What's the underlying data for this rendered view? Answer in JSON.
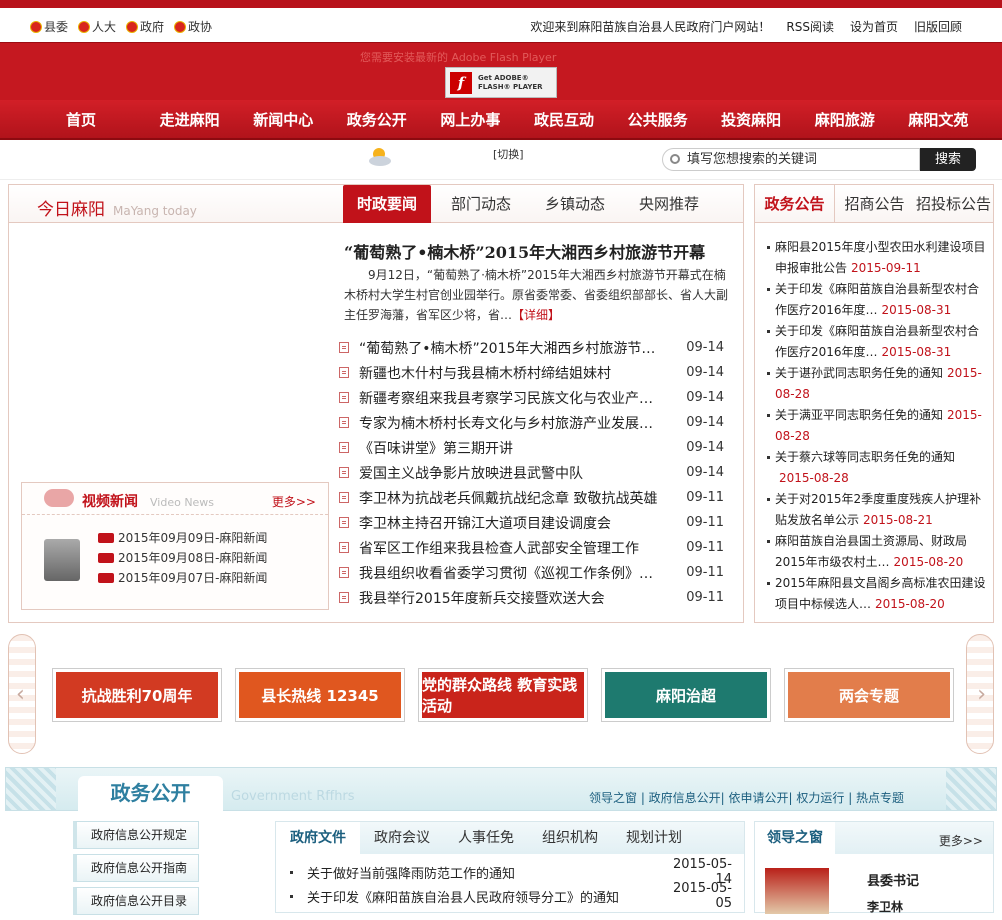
{
  "topbar": {
    "org_links": [
      "县委",
      "人大",
      "政府",
      "政协"
    ],
    "welcome": "欢迎来到麻阳苗族自治县人民政府门户网站！",
    "rss": "RSS阅读",
    "set_home": "设为首页",
    "old_version": "旧版回顾"
  },
  "banner": {
    "flash_hint": "您需要安装最新的 Adobe Flash Player",
    "flash_btn_line1": "Get ADOBE®",
    "flash_btn_line2": "FLASH® PLAYER"
  },
  "nav": [
    "首页",
    "走进麻阳",
    "新闻中心",
    "政务公开",
    "网上办事",
    "政民互动",
    "公共服务",
    "投资麻阳",
    "麻阳旅游",
    "麻阳文苑"
  ],
  "search": {
    "switch": "[切换]",
    "placeholder": "填写您想搜索的关键词",
    "button": "搜索"
  },
  "today": {
    "title": "今日麻阳",
    "title_en": "MaYang today",
    "tabs": [
      "时政要闻",
      "部门动态",
      "乡镇动态",
      "央网推荐"
    ],
    "headline": "“葡萄熟了•楠木桥”2015年大湘西乡村旅游节开幕",
    "summary": "9月12日，“葡萄熟了·楠木桥”2015年大湘西乡村旅游节开幕式在楠木桥村大学生村官创业园举行。原省委常委、省委组织部部长、省人大副主任罗海藩，省军区少将，省…",
    "more": "【详细】",
    "news": [
      {
        "title": "“葡萄熟了•楠木桥”2015年大湘西乡村旅游节…",
        "date": "09-14"
      },
      {
        "title": "新疆也木什村与我县楠木桥村缔结姐妹村",
        "date": "09-14"
      },
      {
        "title": "新疆考察组来我县考察学习民族文化与农业产业…",
        "date": "09-14"
      },
      {
        "title": "专家为楠木桥村长寿文化与乡村旅游产业发展把…",
        "date": "09-14"
      },
      {
        "title": "《百味讲堂》第三期开讲",
        "date": "09-14"
      },
      {
        "title": "爱国主义战争影片放映进县武警中队",
        "date": "09-14"
      },
      {
        "title": "李卫林为抗战老兵佩戴抗战纪念章 致敬抗战英雄",
        "date": "09-11"
      },
      {
        "title": "李卫林主持召开锦江大道项目建设调度会",
        "date": "09-11"
      },
      {
        "title": "省军区工作组来我县检查人武部安全管理工作",
        "date": "09-11"
      },
      {
        "title": "我县组织收看省委学习贯彻《巡视工作条例》电…",
        "date": "09-11"
      },
      {
        "title": "我县举行2015年度新兵交接暨欢送大会",
        "date": "09-11"
      }
    ]
  },
  "video": {
    "title": "视频新闻",
    "title_en": "Video  News",
    "more": "更多>>",
    "items": [
      "2015年09月09日-麻阳新闻",
      "2015年09月08日-麻阳新闻",
      "2015年09月07日-麻阳新闻"
    ]
  },
  "notice": {
    "tabs": [
      "政务公告",
      "招商公告",
      "招投标公告"
    ],
    "items": [
      {
        "title": "麻阳县2015年度小型农田水利建设项目申报审批公告",
        "date": "2015-09-11"
      },
      {
        "title": "关于印发《麻阳苗族自治县新型农村合作医疗2016年度…",
        "date": "2015-08-31"
      },
      {
        "title": "关于印发《麻阳苗族自治县新型农村合作医疗2016年度…",
        "date": "2015-08-31"
      },
      {
        "title": "关于谌孙武同志职务任免的通知",
        "date": "2015-08-28"
      },
      {
        "title": "关于满亚平同志职务任免的通知",
        "date": "2015-08-28"
      },
      {
        "title": "关于蔡六球等同志职务任免的通知",
        "date": "2015-08-28"
      },
      {
        "title": "关于对2015年2季度重度残疾人护理补贴发放名单公示",
        "date": "2015-08-21"
      },
      {
        "title": "麻阳苗族自治县国土资源局、财政局2015年市级农村土…",
        "date": "2015-08-20"
      },
      {
        "title": "2015年麻阳县文昌阁乡高标准农田建设项目中标候选人…",
        "date": "2015-08-20"
      }
    ]
  },
  "banners": [
    {
      "label": "抗战胜利70周年",
      "color": "#d23a22"
    },
    {
      "label": "县长热线 12345",
      "color": "#e0571f"
    },
    {
      "label": "党的群众路线 教育实践活动",
      "color": "#c9241b"
    },
    {
      "label": "麻阳治超",
      "color": "#1e7a6f"
    },
    {
      "label": "两会专题",
      "color": "#e27d4b"
    }
  ],
  "section2": {
    "title": "政务公开",
    "title_en": "Government Rffhrs",
    "links": "领导之窗 | 政府信息公开| 依申请公开| 权力运行 | 热点专题"
  },
  "leftmenu": [
    "政府信息公开规定",
    "政府信息公开指南",
    "政府信息公开目录"
  ],
  "gov": {
    "tabs": [
      "政府文件",
      "政府会议",
      "人事任免",
      "组织机构",
      "规划计划"
    ],
    "items": [
      {
        "title": "关于做好当前强降雨防范工作的通知",
        "date": "2015-05-14"
      },
      {
        "title": "关于印发《麻阳苗族自治县人民政府领导分工》的通知",
        "date": "2015-05-05"
      }
    ]
  },
  "leaders": {
    "title": "领导之窗",
    "more": "更多>>",
    "role": "县委书记",
    "name": "李卫林"
  }
}
